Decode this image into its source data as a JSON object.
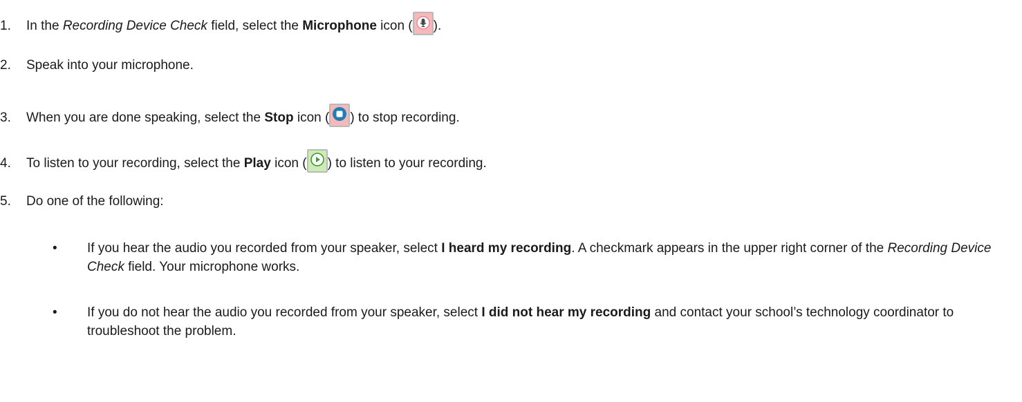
{
  "steps": [
    {
      "num": "1.",
      "text_before_italic": "In the ",
      "italic": "Recording Device Check",
      "text_mid": " field, select the ",
      "bold": "Microphone",
      "text_after_bold": " icon (",
      "icon": "microphone-icon",
      "text_after_icon": ")."
    },
    {
      "num": "2.",
      "text": "Speak into your microphone."
    },
    {
      "num": "3.",
      "text_before_bold": "When you are done speaking, select the ",
      "bold": "Stop",
      "text_after_bold": " icon (",
      "icon": "stop-icon",
      "text_after_icon": ") to stop recording."
    },
    {
      "num": "4.",
      "text_before_bold": "To listen to your recording, select the ",
      "bold": "Play",
      "text_after_bold": " icon (",
      "icon": "play-icon",
      "text_after_icon": ") to listen to your recording."
    },
    {
      "num": "5.",
      "text": "Do one of the following:"
    }
  ],
  "bullets": [
    {
      "marker": "•",
      "text_before_bold": "If you hear the audio you recorded from your speaker, select ",
      "bold": "I heard my recording",
      "text_mid": ". A checkmark appears in the upper right corner of the ",
      "italic": "Recording Device Check",
      "text_end": " field. Your microphone works."
    },
    {
      "marker": "•",
      "text_before_bold": "If you do not hear the audio you recorded from your speaker, select ",
      "bold": "I did not hear my recording",
      "text_end": " and contact your school’s technology coordinator to troubleshoot the problem."
    }
  ],
  "colors": {
    "mic_bg": "#f7b8bc",
    "stop_bg": "#f7b8bc",
    "play_bg": "#cdebb5",
    "stop_blue": "#1f7fb5",
    "play_green": "#3e9b2e"
  }
}
